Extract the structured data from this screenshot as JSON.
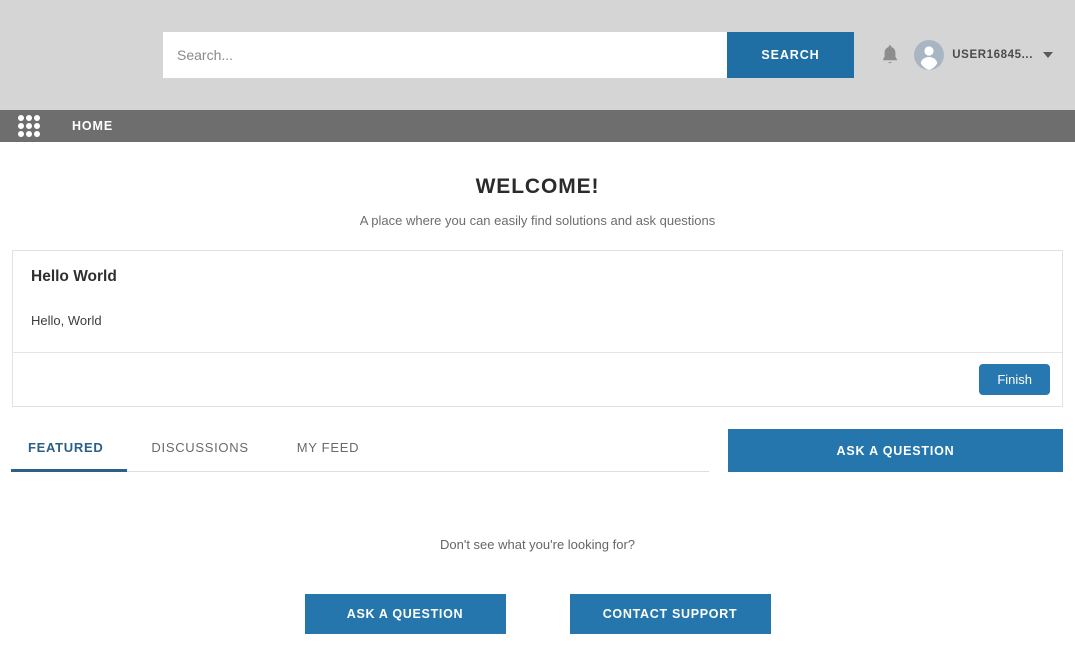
{
  "topbar": {
    "search": {
      "placeholder": "Search...",
      "value": "",
      "button_label": "SEARCH"
    },
    "notifications_icon": "bell-icon",
    "user": {
      "name": "USER16845...",
      "avatar_icon": "user-avatar-icon",
      "dropdown_icon": "chevron-down-icon"
    }
  },
  "navbar": {
    "apps_icon": "grid-apps-icon",
    "items": [
      {
        "label": "HOME"
      }
    ]
  },
  "welcome": {
    "title": "WELCOME!",
    "subtitle": "A place where you can easily find solutions and ask questions"
  },
  "card": {
    "title": "Hello World",
    "body": "Hello, World",
    "footer_button": "Finish"
  },
  "tabs": [
    {
      "label": "FEATURED",
      "active": true
    },
    {
      "label": "DISCUSSIONS",
      "active": false
    },
    {
      "label": "MY FEED",
      "active": false
    }
  ],
  "ask_side_button": "ASK A QUESTION",
  "empty_state": {
    "text": "Don't see what you're looking for?",
    "buttons": [
      {
        "label": "ASK A QUESTION"
      },
      {
        "label": "CONTACT SUPPORT"
      }
    ]
  },
  "colors": {
    "accent_blue": "#1f6fa5",
    "button_blue": "#2476ac",
    "topbar_gray": "#d5d5d5",
    "navbar_gray": "#6e6e6e",
    "tab_active": "#2b6087"
  }
}
